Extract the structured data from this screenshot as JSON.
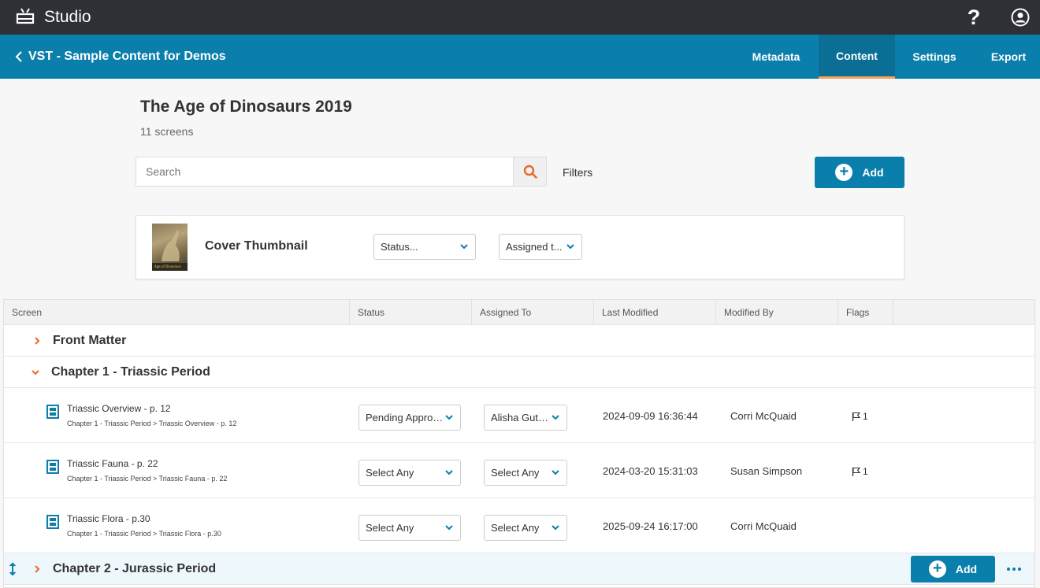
{
  "app": {
    "title": "Studio"
  },
  "header": {
    "back_title": "VST - Sample Content for Demos",
    "tabs": [
      {
        "label": "Metadata",
        "active": false
      },
      {
        "label": "Content",
        "active": true
      },
      {
        "label": "Settings",
        "active": false
      },
      {
        "label": "Export",
        "active": false
      }
    ]
  },
  "page": {
    "title": "The Age of Dinosaurs 2019",
    "subtitle": "11 screens"
  },
  "search": {
    "placeholder": "Search",
    "value": ""
  },
  "filters_label": "Filters",
  "add_label": "Add",
  "cover": {
    "title": "Cover Thumbnail",
    "status_select": "Status...",
    "assigned_select": "Assigned t..."
  },
  "table": {
    "columns": [
      "Screen",
      "Status",
      "Assigned To",
      "Last Modified",
      "Modified By",
      "Flags"
    ],
    "groups": [
      {
        "title": "Front Matter",
        "expanded": false
      },
      {
        "title": "Chapter 1 - Triassic Period",
        "expanded": true
      },
      {
        "title": "Chapter 2 - Jurassic Period",
        "expanded": false
      }
    ],
    "rows": [
      {
        "title": "Triassic Overview - p. 12",
        "path": "Chapter 1 - Triassic Period > Triassic Overview - p. 12",
        "status": "Pending Approv...",
        "assigned": "Alisha Guth...",
        "modified": "2024-09-09 16:36:44",
        "modified_by": "Corri McQuaid",
        "flags": "1"
      },
      {
        "title": "Triassic Fauna - p. 22",
        "path": "Chapter 1 - Triassic Period > Triassic Fauna - p. 22",
        "status": "Select Any",
        "assigned": "Select Any",
        "modified": "2024-03-20 15:31:03",
        "modified_by": "Susan Simpson",
        "flags": "1"
      },
      {
        "title": "Triassic Flora - p.30",
        "path": "Chapter 1 - Triassic Period > Triassic Flora - p.30",
        "status": "Select Any",
        "assigned": "Select Any",
        "modified": "2025-09-24 16:17:00",
        "modified_by": "Corri McQuaid",
        "flags": ""
      }
    ]
  },
  "colors": {
    "topbar": "#2f2f36",
    "brand": "#0b7fab",
    "accent": "#e8692a",
    "tab_underline": "#f5a25d"
  },
  "icons": [
    "tv-logo-icon",
    "help-icon",
    "user-circle-icon",
    "chevron-left-icon",
    "search-icon",
    "plus-circle-icon",
    "chevron-down-icon",
    "chevron-right-icon",
    "screen-icon",
    "flag-icon",
    "drag-handle-icon",
    "more-icon"
  ]
}
